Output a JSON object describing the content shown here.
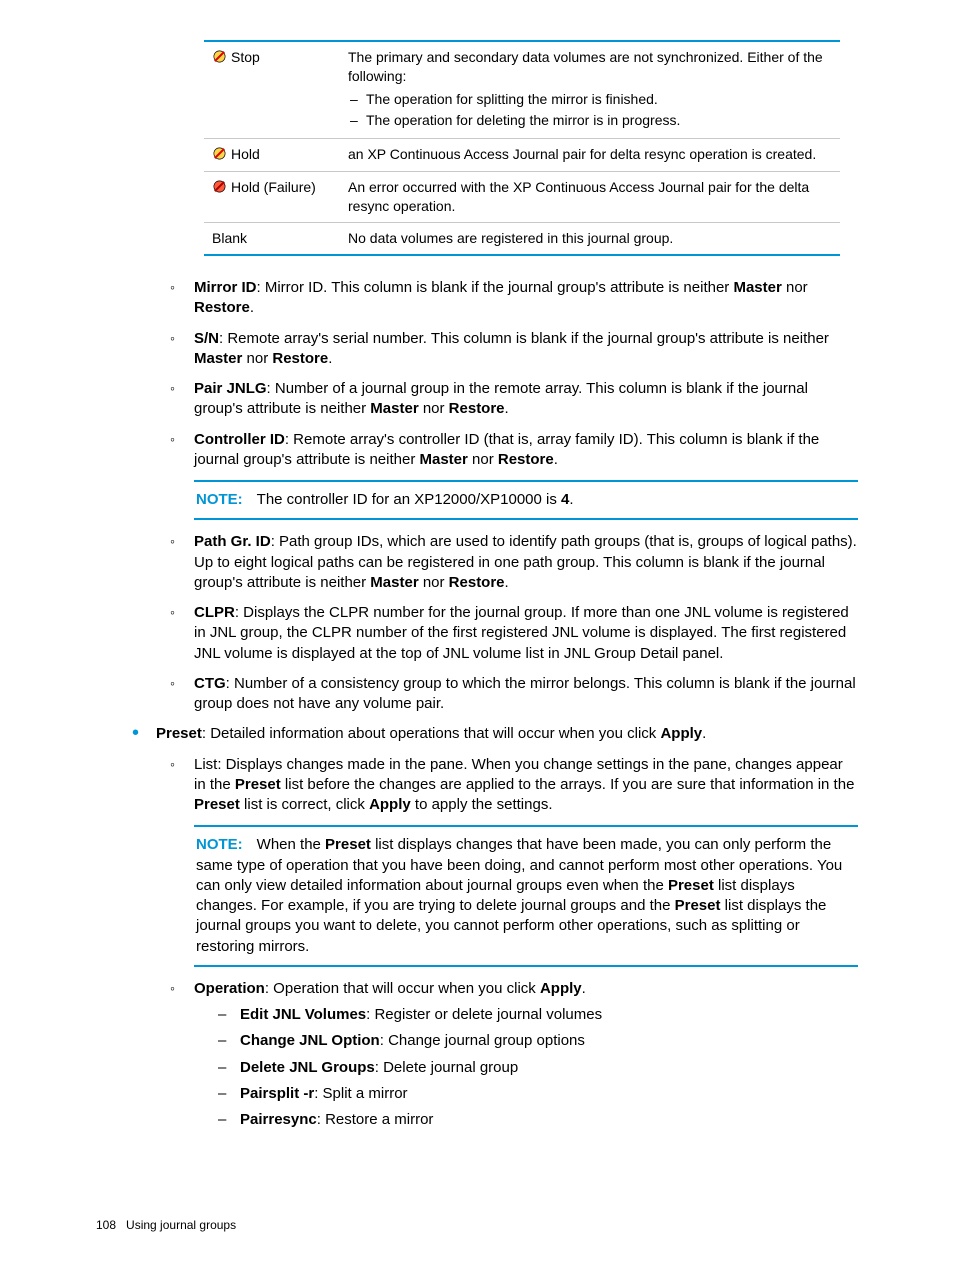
{
  "table": {
    "rows": [
      {
        "label": "Stop",
        "icon": "stop",
        "desc": "The primary and secondary data volumes are not synchronized. Either of the following:",
        "bullets": [
          "The operation for splitting the mirror is finished.",
          "The operation for deleting the mirror is in progress."
        ]
      },
      {
        "label": "Hold",
        "icon": "stop-yellow",
        "desc": "an XP Continuous Access Journal pair for delta resync operation is created."
      },
      {
        "label": "Hold (Failure)",
        "icon": "stop-red",
        "desc": "An error occurred with the XP Continuous Access Journal pair for the delta resync operation."
      },
      {
        "label": "Blank",
        "desc": "No data volumes are registered in this journal group."
      }
    ]
  },
  "defs": {
    "mirror_id": {
      "term": "Mirror ID",
      "rest": ": Mirror ID. This column is blank if the journal group's attribute is neither ",
      "m": "Master",
      "nor": " nor ",
      "r": "Restore",
      "end": "."
    },
    "sn": {
      "term": "S/N",
      "rest": ": Remote array's serial number. This column is blank if the journal group's attribute is neither ",
      "m": "Master",
      "nor": " nor ",
      "r": "Restore",
      "end": "."
    },
    "pair_jnlg": {
      "term": "Pair JNLG",
      "rest": ": Number of a journal group in the remote array. This column is blank if the journal group's attribute is neither ",
      "m": "Master",
      "nor": " nor ",
      "r": "Restore",
      "end": "."
    },
    "controller_id": {
      "term": "Controller ID",
      "rest": ": Remote array's controller ID (that is, array family ID). This column is blank if the journal group's attribute is neither ",
      "m": "Master",
      "nor": " nor ",
      "r": "Restore",
      "end": "."
    },
    "controller_note": {
      "label": "NOTE:",
      "pre": "The controller ID for an XP12000/XP10000 is ",
      "val": "4",
      "end": "."
    },
    "path_gr": {
      "term": "Path Gr. ID",
      "rest": ": Path group IDs, which are used to identify path groups (that is, groups of logical paths). Up to eight logical paths can be registered in one path group. This column is blank if the journal group's attribute is neither ",
      "m": "Master",
      "nor": " nor ",
      "r": "Restore",
      "end": "."
    },
    "clpr": {
      "term": "CLPR",
      "rest": ": Displays the CLPR number for the journal group. If more than one JNL volume is registered in JNL group, the CLPR number of the first registered JNL volume is displayed. The first registered JNL volume is displayed at the top of JNL volume list in JNL Group Detail panel."
    },
    "ctg": {
      "term": "CTG",
      "rest": ": Number of a consistency group to which the mirror belongs. This column is blank if the journal group does not have any volume pair."
    }
  },
  "preset": {
    "term": "Preset",
    "rest": ": Detailed information about operations that will occur when you click ",
    "apply": "Apply",
    "end": ".",
    "list_intro_1": "List: Displays changes made in the pane. When you change settings in the pane, changes appear in the ",
    "list_intro_2": " list before the changes are applied to the arrays. If you are sure that information in the ",
    "list_intro_3": " list is correct, click ",
    "list_intro_4": " to apply the settings.",
    "note_label": "NOTE:",
    "note_1": "When the ",
    "note_2": " list displays changes that have been made, you can only perform the same type of operation that you have been doing, and cannot perform most other operations. You can only view detailed information about journal groups even when the ",
    "note_3": " list displays changes. For example, if you are trying to delete journal groups and the ",
    "note_4": " list displays the journal groups you want to delete, you cannot perform other operations, such as splitting or restoring mirrors.",
    "operation": {
      "term": "Operation",
      "rest": ": Operation that will occur when you click ",
      "apply": "Apply",
      "end": "."
    },
    "ops": [
      {
        "term": "Edit JNL Volumes",
        "rest": ": Register or delete journal volumes"
      },
      {
        "term": "Change JNL Option",
        "rest": ": Change journal group options"
      },
      {
        "term": "Delete JNL Groups",
        "rest": ": Delete journal group"
      },
      {
        "term": "Pairsplit -r",
        "rest": ": Split a mirror"
      },
      {
        "term": "Pairresync",
        "rest": ": Restore a mirror"
      }
    ]
  },
  "footer": {
    "page": "108",
    "title": "Using journal groups"
  }
}
